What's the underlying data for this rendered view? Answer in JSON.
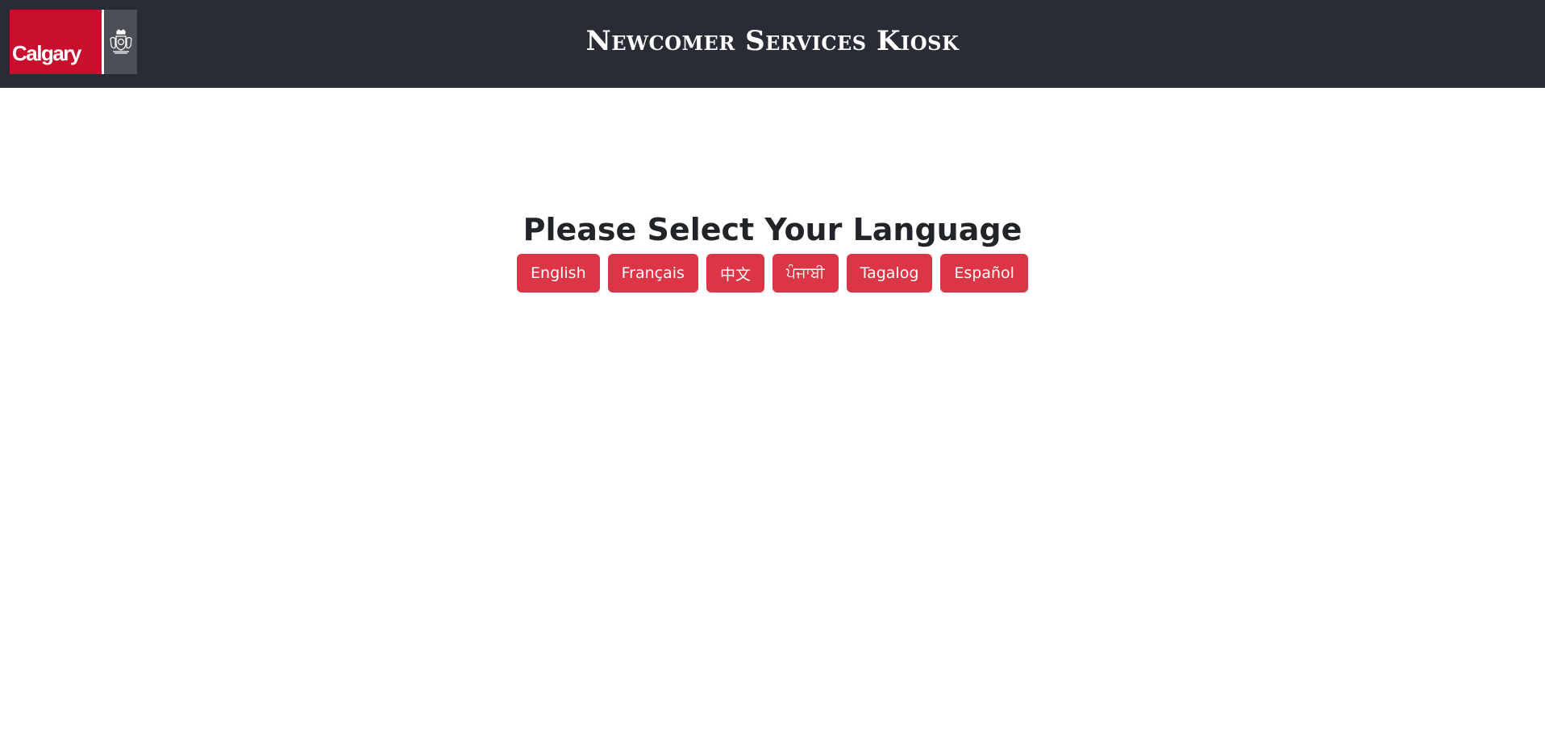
{
  "header": {
    "logo_text": "Calgary",
    "title": "Newcomer Services Kiosk",
    "brand_color": "#c8102e",
    "bg_color": "#292c34",
    "logo_icon": "coat-of-arms-icon"
  },
  "main": {
    "heading": "Please Select Your Language",
    "button_color": "#dc3545",
    "languages": [
      {
        "label": "English"
      },
      {
        "label": "Français"
      },
      {
        "label": "中文"
      },
      {
        "label": "ਪੰਜਾਬੀ"
      },
      {
        "label": "Tagalog"
      },
      {
        "label": "Español"
      }
    ]
  }
}
